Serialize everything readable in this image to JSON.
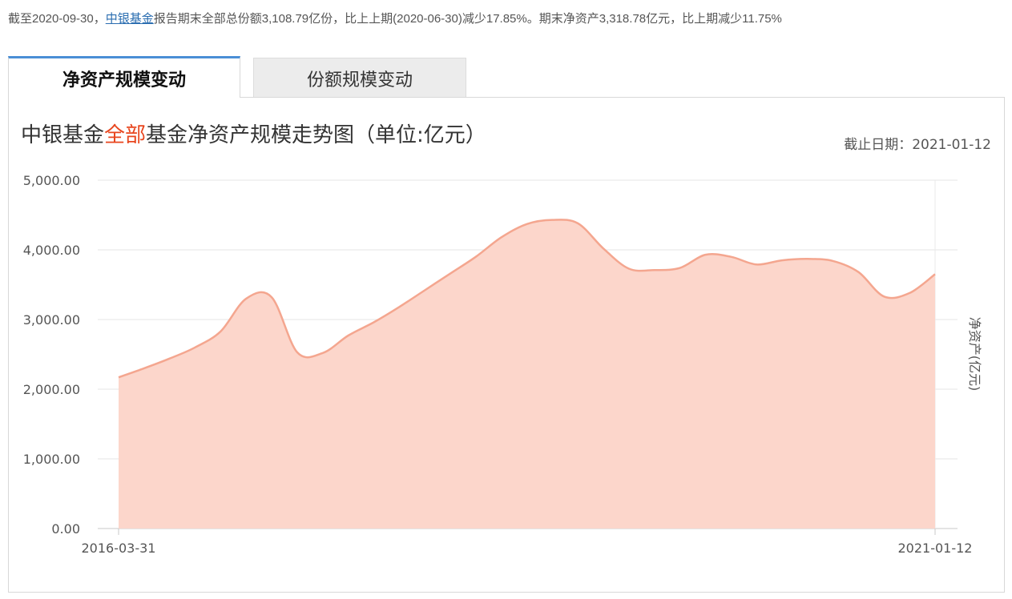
{
  "summary": {
    "prefix": "截至2020-09-30，",
    "company_link": "中银基金",
    "text": "报告期末全部总份额3,108.79亿份，比上上期(2020-06-30)减少17.85%。期末净资产3,318.78亿元，比上期减少11.75%"
  },
  "tabs": [
    {
      "label": "净资产规模变动",
      "active": true
    },
    {
      "label": "份额规模变动",
      "active": false
    }
  ],
  "title_parts": {
    "a": "中银基金",
    "b": "全部",
    "c": "基金净资产规模走势图（单位:亿元）"
  },
  "date_note": "截止日期：2021-01-12",
  "colors": {
    "line": "#f4a68f",
    "fill": "#fcd6cb",
    "highlight": "#e8461e",
    "tab_accent": "#4a8fd6"
  },
  "chart_data": {
    "type": "area",
    "title": "中银基金全部基金净资产规模走势图（单位:亿元）",
    "x_labels_shown": [
      "2016-03-31",
      "2021-01-12"
    ],
    "y_ticks": [
      "5,000.00",
      "4,000.00",
      "3,000.00",
      "2,000.00",
      "1,000.00",
      "0.00"
    ],
    "ylim": [
      0,
      5000
    ],
    "y2label": "净资产(亿元)",
    "grid": true,
    "series": [
      {
        "values": [
          2170,
          2300,
          2440,
          2600,
          2830,
          3300,
          3320,
          2530,
          2520,
          2770,
          2960,
          3180,
          3420,
          3660,
          3900,
          4180,
          4370,
          4430,
          4380,
          4020,
          3730,
          3710,
          3740,
          3930,
          3900,
          3790,
          3850,
          3870,
          3840,
          3680,
          3330,
          3380,
          3650
        ]
      }
    ]
  }
}
